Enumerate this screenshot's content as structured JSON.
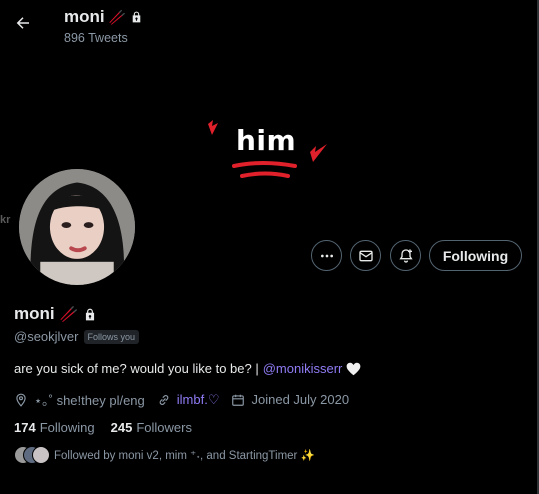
{
  "header": {
    "back_label": "Back",
    "name": "moni",
    "name_emoji": "🥢",
    "tweets_count": "896 Tweets"
  },
  "banner": {
    "text": "him"
  },
  "actions": {
    "more_icon": "more-icon",
    "message_icon": "envelope-icon",
    "notify_icon": "bell-plus-icon",
    "follow_label": "Following"
  },
  "profile": {
    "name": "moni",
    "name_emoji": "🥢",
    "handle": "@seokjlver",
    "follows_you": "Follows you",
    "bio_text": "are you sick of me? would you like to be? |",
    "bio_mention": "@monikisserr",
    "location": "⋆｡˚ she!they pl/eng",
    "link": "ilmbf.♡",
    "joined": "Joined July 2020",
    "following_count": "174",
    "following_label": "Following",
    "followers_count": "245",
    "followers_label": "Followers",
    "followed_by": "Followed by moni v2, mim ⁺˖, and StartingTimer ✨"
  },
  "colors": {
    "accent": "#8e7cf5",
    "muted": "#8b98a5",
    "border": "#536471",
    "banner_red": "#e0202a"
  }
}
